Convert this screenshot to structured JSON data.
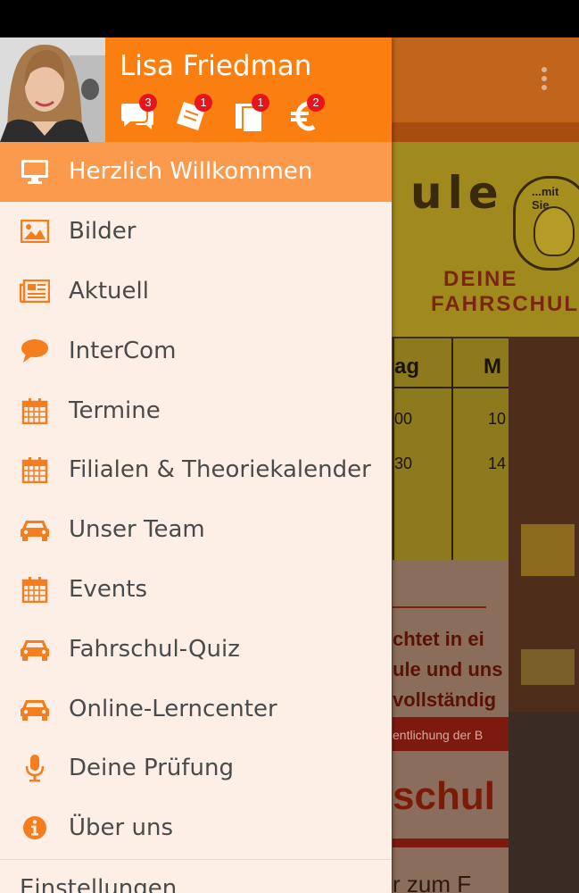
{
  "profile": {
    "name": "Lisa Friedman",
    "icons": [
      {
        "icon": "chat-icon",
        "badge": "3"
      },
      {
        "icon": "ticket-icon",
        "badge": "1"
      },
      {
        "icon": "documents-icon",
        "badge": "1"
      },
      {
        "icon": "euro-icon",
        "badge": "2"
      }
    ]
  },
  "menu": {
    "items": [
      {
        "label": "Herzlich Willkommen",
        "icon": "monitor-icon",
        "active": true
      },
      {
        "label": "Bilder",
        "icon": "image-icon"
      },
      {
        "label": "Aktuell",
        "icon": "newspaper-icon"
      },
      {
        "label": "InterCom",
        "icon": "speech-bubble-icon"
      },
      {
        "label": "Termine",
        "icon": "calendar-icon"
      },
      {
        "label": "Filialen & Theoriekalender",
        "icon": "calendar-icon"
      },
      {
        "label": "Unser Team",
        "icon": "car-icon"
      },
      {
        "label": "Events",
        "icon": "calendar-icon"
      },
      {
        "label": "Fahrschul-Quiz",
        "icon": "car-icon"
      },
      {
        "label": "Online-Lerncenter",
        "icon": "car-icon"
      },
      {
        "label": "Deine Prüfung",
        "icon": "microphone-icon"
      },
      {
        "label": "Über uns",
        "icon": "info-icon"
      }
    ],
    "settings_label": "Einstellungen"
  },
  "background": {
    "banner_title": "ule",
    "banner_badge": "...mit Sie",
    "banner_line1": "DEINE",
    "banner_line2": "FAHRSCHULE",
    "schedule_head1": "ag",
    "schedule_head2": "M",
    "schedule_rows": [
      {
        "a": "00",
        "b": "10"
      },
      {
        "a": "30",
        "b": "14"
      }
    ],
    "article_line1": "chtet in ei",
    "article_line2": "ule und uns",
    "article_line3": "vollständig",
    "article_red": "entlichung der B",
    "article_big": "schul",
    "article_bottom": "r zum F"
  },
  "colors": {
    "accent": "#fa7f10",
    "active_row": "#fb9a4c",
    "drawer_bg": "#fdeee6",
    "badge": "#e8141c",
    "icon": "#f47d1d"
  }
}
